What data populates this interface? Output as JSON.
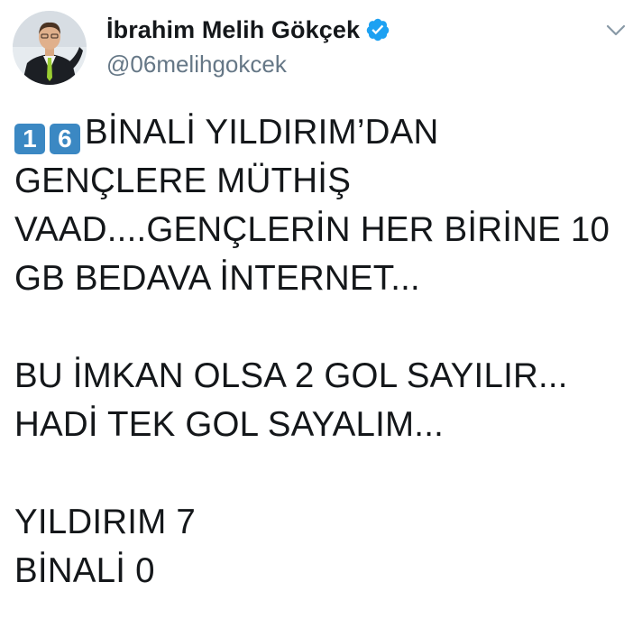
{
  "user": {
    "display_name": "İbrahim Melih Gökçek",
    "handle": "@06melihgokcek",
    "verified_icon": "verified-badge-icon"
  },
  "menu": {
    "icon": "chevron-down-icon"
  },
  "tweet": {
    "keycaps": [
      "1",
      "6"
    ],
    "line1_rest": "BİNALİ YILDIRIM’DAN",
    "lines_after_first": [
      "GENÇLERE MÜTHİŞ",
      "VAAD....GENÇLERİN HER BİRİNE 10",
      "GB BEDAVA İNTERNET..."
    ],
    "paragraph2": [
      "BU İMKAN OLSA 2 GOL SAYILIR...",
      "HADİ TEK GOL SAYALIM..."
    ],
    "paragraph3": [
      "YILDIRIM 7",
      "BİNALİ 0"
    ]
  },
  "colors": {
    "text": "#14171a",
    "secondary": "#657786",
    "verified": "#1da1f2",
    "keycap": "#3b88c3"
  }
}
